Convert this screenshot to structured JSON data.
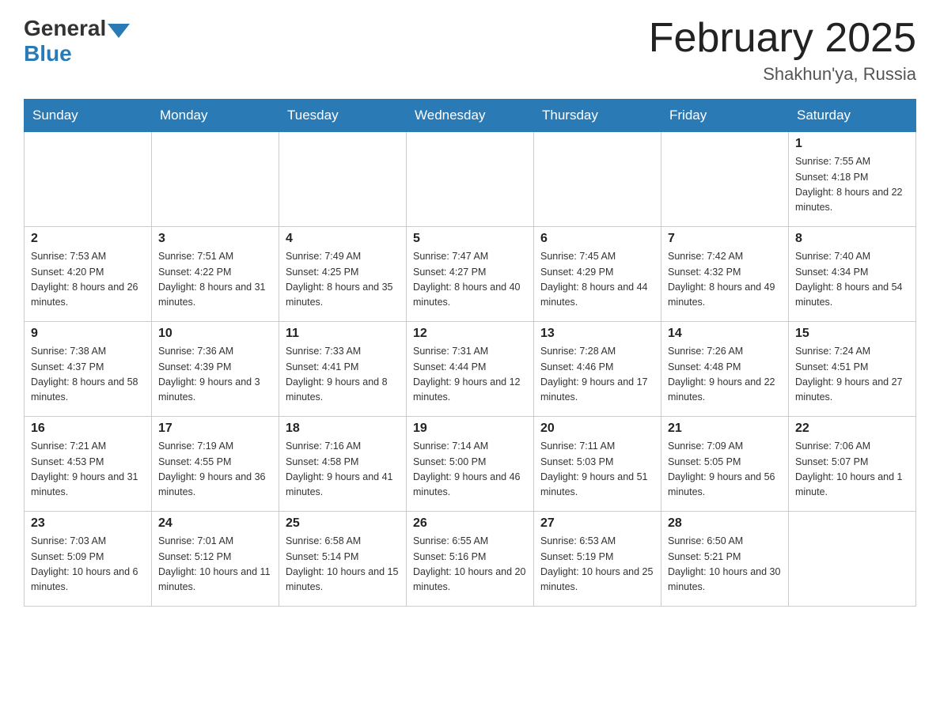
{
  "header": {
    "logo_general": "General",
    "logo_blue": "Blue",
    "month_title": "February 2025",
    "location": "Shakhun'ya, Russia"
  },
  "weekdays": [
    "Sunday",
    "Monday",
    "Tuesday",
    "Wednesday",
    "Thursday",
    "Friday",
    "Saturday"
  ],
  "weeks": [
    [
      {
        "day": "",
        "sunrise": "",
        "sunset": "",
        "daylight": ""
      },
      {
        "day": "",
        "sunrise": "",
        "sunset": "",
        "daylight": ""
      },
      {
        "day": "",
        "sunrise": "",
        "sunset": "",
        "daylight": ""
      },
      {
        "day": "",
        "sunrise": "",
        "sunset": "",
        "daylight": ""
      },
      {
        "day": "",
        "sunrise": "",
        "sunset": "",
        "daylight": ""
      },
      {
        "day": "",
        "sunrise": "",
        "sunset": "",
        "daylight": ""
      },
      {
        "day": "1",
        "sunrise": "Sunrise: 7:55 AM",
        "sunset": "Sunset: 4:18 PM",
        "daylight": "Daylight: 8 hours and 22 minutes."
      }
    ],
    [
      {
        "day": "2",
        "sunrise": "Sunrise: 7:53 AM",
        "sunset": "Sunset: 4:20 PM",
        "daylight": "Daylight: 8 hours and 26 minutes."
      },
      {
        "day": "3",
        "sunrise": "Sunrise: 7:51 AM",
        "sunset": "Sunset: 4:22 PM",
        "daylight": "Daylight: 8 hours and 31 minutes."
      },
      {
        "day": "4",
        "sunrise": "Sunrise: 7:49 AM",
        "sunset": "Sunset: 4:25 PM",
        "daylight": "Daylight: 8 hours and 35 minutes."
      },
      {
        "day": "5",
        "sunrise": "Sunrise: 7:47 AM",
        "sunset": "Sunset: 4:27 PM",
        "daylight": "Daylight: 8 hours and 40 minutes."
      },
      {
        "day": "6",
        "sunrise": "Sunrise: 7:45 AM",
        "sunset": "Sunset: 4:29 PM",
        "daylight": "Daylight: 8 hours and 44 minutes."
      },
      {
        "day": "7",
        "sunrise": "Sunrise: 7:42 AM",
        "sunset": "Sunset: 4:32 PM",
        "daylight": "Daylight: 8 hours and 49 minutes."
      },
      {
        "day": "8",
        "sunrise": "Sunrise: 7:40 AM",
        "sunset": "Sunset: 4:34 PM",
        "daylight": "Daylight: 8 hours and 54 minutes."
      }
    ],
    [
      {
        "day": "9",
        "sunrise": "Sunrise: 7:38 AM",
        "sunset": "Sunset: 4:37 PM",
        "daylight": "Daylight: 8 hours and 58 minutes."
      },
      {
        "day": "10",
        "sunrise": "Sunrise: 7:36 AM",
        "sunset": "Sunset: 4:39 PM",
        "daylight": "Daylight: 9 hours and 3 minutes."
      },
      {
        "day": "11",
        "sunrise": "Sunrise: 7:33 AM",
        "sunset": "Sunset: 4:41 PM",
        "daylight": "Daylight: 9 hours and 8 minutes."
      },
      {
        "day": "12",
        "sunrise": "Sunrise: 7:31 AM",
        "sunset": "Sunset: 4:44 PM",
        "daylight": "Daylight: 9 hours and 12 minutes."
      },
      {
        "day": "13",
        "sunrise": "Sunrise: 7:28 AM",
        "sunset": "Sunset: 4:46 PM",
        "daylight": "Daylight: 9 hours and 17 minutes."
      },
      {
        "day": "14",
        "sunrise": "Sunrise: 7:26 AM",
        "sunset": "Sunset: 4:48 PM",
        "daylight": "Daylight: 9 hours and 22 minutes."
      },
      {
        "day": "15",
        "sunrise": "Sunrise: 7:24 AM",
        "sunset": "Sunset: 4:51 PM",
        "daylight": "Daylight: 9 hours and 27 minutes."
      }
    ],
    [
      {
        "day": "16",
        "sunrise": "Sunrise: 7:21 AM",
        "sunset": "Sunset: 4:53 PM",
        "daylight": "Daylight: 9 hours and 31 minutes."
      },
      {
        "day": "17",
        "sunrise": "Sunrise: 7:19 AM",
        "sunset": "Sunset: 4:55 PM",
        "daylight": "Daylight: 9 hours and 36 minutes."
      },
      {
        "day": "18",
        "sunrise": "Sunrise: 7:16 AM",
        "sunset": "Sunset: 4:58 PM",
        "daylight": "Daylight: 9 hours and 41 minutes."
      },
      {
        "day": "19",
        "sunrise": "Sunrise: 7:14 AM",
        "sunset": "Sunset: 5:00 PM",
        "daylight": "Daylight: 9 hours and 46 minutes."
      },
      {
        "day": "20",
        "sunrise": "Sunrise: 7:11 AM",
        "sunset": "Sunset: 5:03 PM",
        "daylight": "Daylight: 9 hours and 51 minutes."
      },
      {
        "day": "21",
        "sunrise": "Sunrise: 7:09 AM",
        "sunset": "Sunset: 5:05 PM",
        "daylight": "Daylight: 9 hours and 56 minutes."
      },
      {
        "day": "22",
        "sunrise": "Sunrise: 7:06 AM",
        "sunset": "Sunset: 5:07 PM",
        "daylight": "Daylight: 10 hours and 1 minute."
      }
    ],
    [
      {
        "day": "23",
        "sunrise": "Sunrise: 7:03 AM",
        "sunset": "Sunset: 5:09 PM",
        "daylight": "Daylight: 10 hours and 6 minutes."
      },
      {
        "day": "24",
        "sunrise": "Sunrise: 7:01 AM",
        "sunset": "Sunset: 5:12 PM",
        "daylight": "Daylight: 10 hours and 11 minutes."
      },
      {
        "day": "25",
        "sunrise": "Sunrise: 6:58 AM",
        "sunset": "Sunset: 5:14 PM",
        "daylight": "Daylight: 10 hours and 15 minutes."
      },
      {
        "day": "26",
        "sunrise": "Sunrise: 6:55 AM",
        "sunset": "Sunset: 5:16 PM",
        "daylight": "Daylight: 10 hours and 20 minutes."
      },
      {
        "day": "27",
        "sunrise": "Sunrise: 6:53 AM",
        "sunset": "Sunset: 5:19 PM",
        "daylight": "Daylight: 10 hours and 25 minutes."
      },
      {
        "day": "28",
        "sunrise": "Sunrise: 6:50 AM",
        "sunset": "Sunset: 5:21 PM",
        "daylight": "Daylight: 10 hours and 30 minutes."
      },
      {
        "day": "",
        "sunrise": "",
        "sunset": "",
        "daylight": ""
      }
    ]
  ]
}
